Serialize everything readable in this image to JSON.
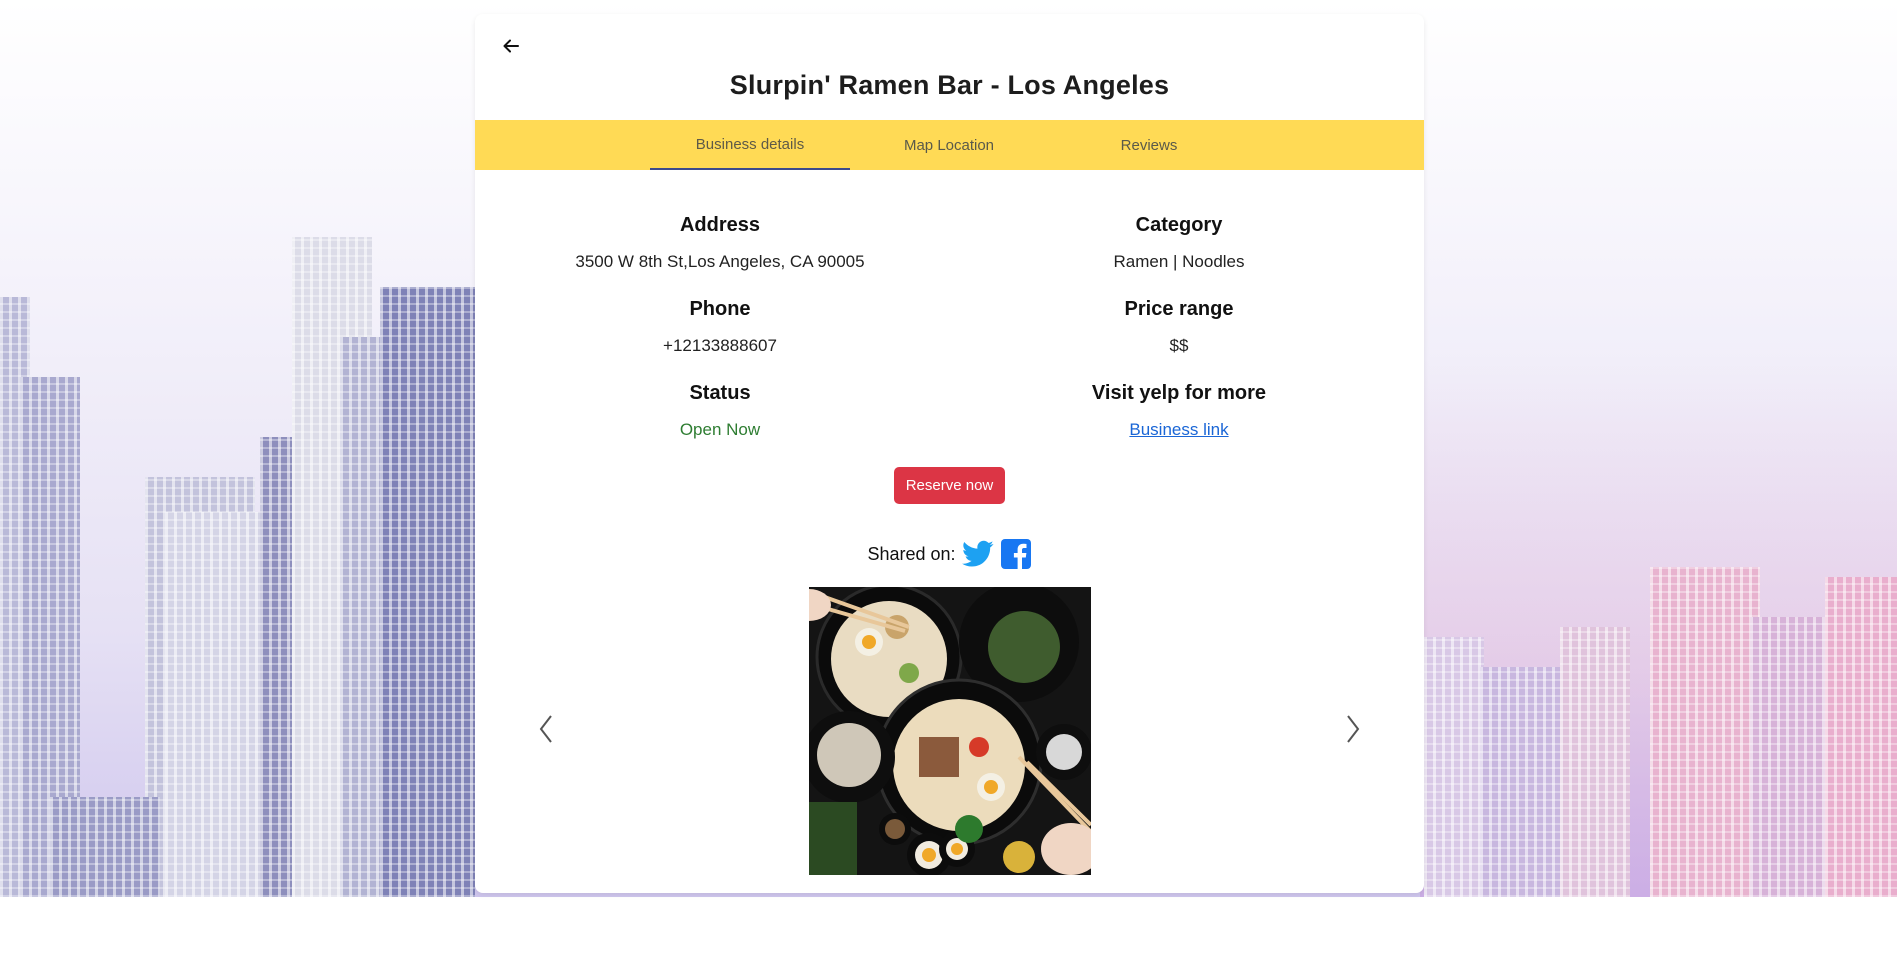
{
  "page": {
    "title": "Slurpin' Ramen Bar - Los Angeles"
  },
  "tabs": [
    {
      "label": "Business details",
      "active": true
    },
    {
      "label": "Map Location",
      "active": false
    },
    {
      "label": "Reviews",
      "active": false
    }
  ],
  "details": {
    "address_label": "Address",
    "address_value": "3500 W 8th St,Los Angeles, CA 90005",
    "phone_label": "Phone",
    "phone_value": "+12133888607",
    "status_label": "Status",
    "status_value": "Open Now",
    "category_label": "Category",
    "category_value": "Ramen | Noodles",
    "price_label": "Price range",
    "price_value": "$$",
    "yelp_label": "Visit yelp for more",
    "yelp_link": "Business link"
  },
  "actions": {
    "reserve_label": "Reserve now",
    "shared_label": "Shared on:"
  },
  "icons": [
    "back-arrow-icon",
    "twitter-icon",
    "facebook-icon",
    "chevron-left-icon",
    "chevron-right-icon"
  ],
  "colors": {
    "tab_bar": "#ffda55",
    "tab_indicator": "#3c4a8c",
    "reserve_button": "#dc3545",
    "status_open": "#2e7d32",
    "link": "#1a66d6",
    "twitter": "#1da1f2",
    "facebook": "#1877f2"
  }
}
